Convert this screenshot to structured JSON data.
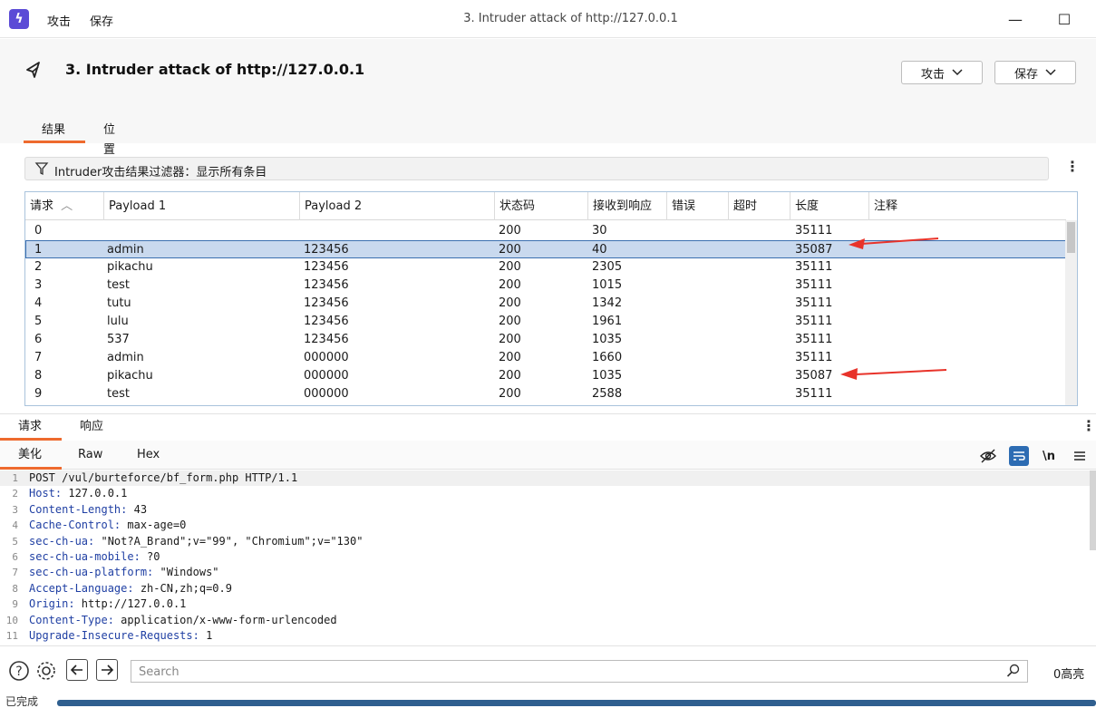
{
  "titlebar": {
    "menu": [
      "攻击",
      "保存"
    ],
    "window_title": "3. Intruder attack of http://127.0.0.1",
    "minimize": "—",
    "maximize": "☐"
  },
  "header": {
    "title": "3. Intruder attack of http://127.0.0.1",
    "attack_button": "攻击",
    "save_button": "保存"
  },
  "result_tabs": [
    "结果",
    "位置"
  ],
  "filter": {
    "label": "Intruder攻击结果过滤器：显示所有条目"
  },
  "table": {
    "columns": [
      "请求",
      "Payload 1",
      "Payload 2",
      "状态码",
      "接收到响应",
      "错误",
      "超时",
      "长度",
      "注释"
    ],
    "sort_indicator": "︿",
    "rows": [
      [
        "0",
        "",
        "",
        "200",
        "30",
        "",
        "",
        "35111",
        ""
      ],
      [
        "1",
        "admin",
        "123456",
        "200",
        "40",
        "",
        "",
        "35087",
        ""
      ],
      [
        "2",
        "pikachu",
        "123456",
        "200",
        "2305",
        "",
        "",
        "35111",
        ""
      ],
      [
        "3",
        "test",
        "123456",
        "200",
        "1015",
        "",
        "",
        "35111",
        ""
      ],
      [
        "4",
        "tutu",
        "123456",
        "200",
        "1342",
        "",
        "",
        "35111",
        ""
      ],
      [
        "5",
        "lulu",
        "123456",
        "200",
        "1961",
        "",
        "",
        "35111",
        ""
      ],
      [
        "6",
        "537",
        "123456",
        "200",
        "1035",
        "",
        "",
        "35111",
        ""
      ],
      [
        "7",
        "admin",
        "000000",
        "200",
        "1660",
        "",
        "",
        "35111",
        ""
      ],
      [
        "8",
        "pikachu",
        "000000",
        "200",
        "1035",
        "",
        "",
        "35087",
        ""
      ],
      [
        "9",
        "test",
        "000000",
        "200",
        "2588",
        "",
        "",
        "35111",
        ""
      ]
    ],
    "selected_row": 1
  },
  "req_resp_tabs": [
    "请求",
    "响应"
  ],
  "view_tabs": [
    "美化",
    "Raw",
    "Hex"
  ],
  "toolbar": {
    "newline_label": "\\n"
  },
  "code_lines": [
    {
      "n": "1",
      "key": "POST /vul/burteforce/bf_form.php HTTP/1.1",
      "val": ""
    },
    {
      "n": "2",
      "key": "Host:",
      "val": " 127.0.0.1"
    },
    {
      "n": "3",
      "key": "Content-Length:",
      "val": " 43"
    },
    {
      "n": "4",
      "key": "Cache-Control:",
      "val": " max-age=0"
    },
    {
      "n": "5",
      "key": "sec-ch-ua:",
      "val": " \"Not?A_Brand\";v=\"99\", \"Chromium\";v=\"130\""
    },
    {
      "n": "6",
      "key": "sec-ch-ua-mobile:",
      "val": " ?0"
    },
    {
      "n": "7",
      "key": "sec-ch-ua-platform:",
      "val": " \"Windows\""
    },
    {
      "n": "8",
      "key": "Accept-Language:",
      "val": " zh-CN,zh;q=0.9"
    },
    {
      "n": "9",
      "key": "Origin:",
      "val": " http://127.0.0.1"
    },
    {
      "n": "10",
      "key": "Content-Type:",
      "val": " application/x-www-form-urlencoded"
    },
    {
      "n": "11",
      "key": "Upgrade-Insecure-Requests:",
      "val": " 1"
    }
  ],
  "bottom": {
    "search_placeholder": "Search",
    "highlight_count": "0高亮"
  },
  "status": {
    "text": "已完成"
  },
  "colors": {
    "accent": "#ee6a2e",
    "selection": "#c9d9ee",
    "arrow": "#e8332a",
    "progress": "#2f5f8f"
  }
}
